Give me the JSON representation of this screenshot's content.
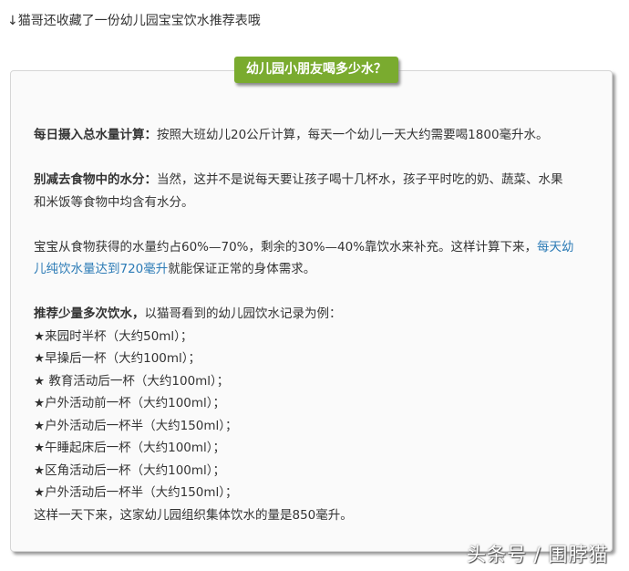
{
  "intro": {
    "arrow": "↓",
    "text": "猫哥还收藏了一份幼儿园宝宝饮水推荐表哦"
  },
  "badge": "幼儿园小朋友喝多少水？",
  "p1": {
    "bold": "每日摄入总水量计算：",
    "text": "按照大班幼儿20公斤计算，每天一个幼儿一天大约需要喝1800毫升水。"
  },
  "p2": {
    "bold": "别减去食物中的水分：",
    "line1": "当然，这并不是说每天要让孩子喝十几杯水，孩子平时吃的奶、蔬菜、水果",
    "line2": "和米饭等食物中均含有水分。"
  },
  "p3": {
    "line1": "宝宝从食物获得的水量约占60%—70%，剩余的30%—40%靠饮水来补充。这样计算下来，",
    "link1": "每天幼",
    "link2": "儿纯饮水量达到720毫升",
    "line2": "就能保证正常的身体需求。"
  },
  "p4": {
    "bold": "推荐少量多次饮水，",
    "text": "以猫哥看到的幼儿园饮水记录为例：",
    "items": [
      "★来园时半杯（大约50ml）；",
      "★早操后一杯（大约100ml）；",
      "★ 教育活动后一杯（大约100ml）；",
      "★户外活动前一杯（大约100ml）；",
      "★户外活动后一杯半（大约150ml）；",
      "★午睡起床后一杯（大约100ml）；",
      "★区角活动后一杯（大约100ml）；",
      "★户外活动后一杯半（大约150ml）；"
    ],
    "summary": "这样一天下来，这家幼儿园组织集体饮水的量是850毫升。"
  },
  "watermark": "头条号 / 围脖猫",
  "colors": {
    "badge": "#7aab2f",
    "link": "#2c7bb6"
  }
}
